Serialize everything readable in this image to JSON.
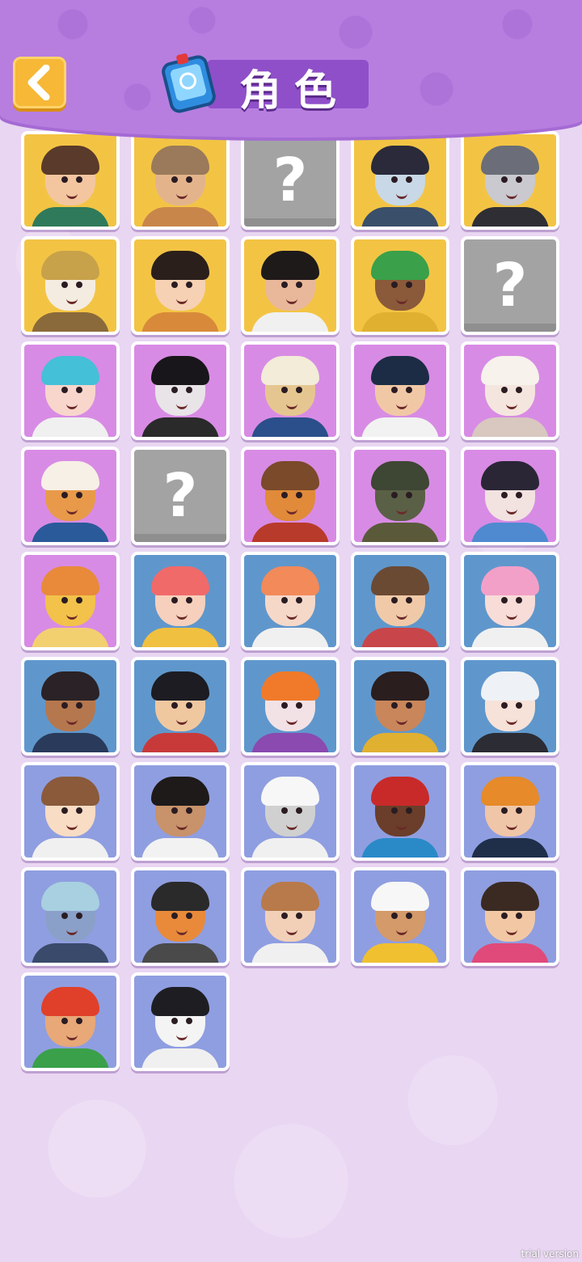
{
  "header": {
    "back_icon": "chevron-left-icon",
    "title_icon": "phone-icon",
    "title": "角色"
  },
  "colors": {
    "header": "#b77ee0",
    "page_bg": "#e9d6f2",
    "back_button": "#f6b836",
    "tier_gold": "#f3c444",
    "tier_purple": "#d88be4",
    "tier_blue": "#5f97cc",
    "tier_periwinkle": "#8f9ee0",
    "locked": "#a3a3a3"
  },
  "characters": [
    {
      "tier": "gold",
      "locked": false,
      "skin": "#f3c6a0",
      "hair": "#5a3a2a",
      "outfit": "#2f7a5a"
    },
    {
      "tier": "gold",
      "locked": false,
      "skin": "#e3b48c",
      "hair": "#9a7a5a",
      "outfit": "#c9864a"
    },
    {
      "tier": "gold",
      "locked": true,
      "label": "?"
    },
    {
      "tier": "gold",
      "locked": false,
      "skin": "#c8d8e6",
      "hair": "#2a2a3a",
      "outfit": "#3a4f6a"
    },
    {
      "tier": "gold",
      "locked": false,
      "skin": "#c9c9cf",
      "hair": "#6b6e78",
      "outfit": "#2e2e34"
    },
    {
      "tier": "gold",
      "locked": false,
      "skin": "#f4ece0",
      "hair": "#c8a24a",
      "outfit": "#8a6a3a"
    },
    {
      "tier": "gold",
      "locked": false,
      "skin": "#f6d1b3",
      "hair": "#2b1f1c",
      "outfit": "#d88a3a"
    },
    {
      "tier": "gold",
      "locked": false,
      "skin": "#e9b89a",
      "hair": "#1f1a1a",
      "outfit": "#f0f0f0"
    },
    {
      "tier": "gold",
      "locked": false,
      "skin": "#8a5a3a",
      "hair": "#3aa04a",
      "outfit": "#e0b030"
    },
    {
      "tier": "gold",
      "locked": true,
      "label": "?"
    },
    {
      "tier": "purple",
      "locked": false,
      "skin": "#f8d6cc",
      "hair": "#44c0d8",
      "outfit": "#f0f0f0"
    },
    {
      "tier": "purple",
      "locked": false,
      "skin": "#e8e4e8",
      "hair": "#18161a",
      "outfit": "#2a2a2a"
    },
    {
      "tier": "purple",
      "locked": false,
      "skin": "#e6c690",
      "hair": "#f2ecd8",
      "outfit": "#2a4f8a"
    },
    {
      "tier": "purple",
      "locked": false,
      "skin": "#f1c8a6",
      "hair": "#1c2c44",
      "outfit": "#f2f2f2"
    },
    {
      "tier": "purple",
      "locked": false,
      "skin": "#f4e6de",
      "hair": "#f7f2ec",
      "outfit": "#d8c8c0"
    },
    {
      "tier": "purple",
      "locked": false,
      "skin": "#e89a4a",
      "hair": "#f7f0e6",
      "outfit": "#2a5a9a"
    },
    {
      "tier": "purple",
      "locked": true,
      "label": "?"
    },
    {
      "tier": "purple",
      "locked": false,
      "skin": "#e08a3a",
      "hair": "#7a4a2a",
      "outfit": "#b83a2a"
    },
    {
      "tier": "purple",
      "locked": false,
      "skin": "#5a6046",
      "hair": "#3e4634",
      "outfit": "#5a5a3a"
    },
    {
      "tier": "purple",
      "locked": false,
      "skin": "#f2e2e0",
      "hair": "#2a2636",
      "outfit": "#4f8ad0"
    },
    {
      "tier": "purple",
      "locked": false,
      "skin": "#f2c24a",
      "hair": "#e88a3a",
      "outfit": "#f2d070"
    },
    {
      "tier": "blue",
      "locked": false,
      "skin": "#f6d0bc",
      "hair": "#f06a6a",
      "outfit": "#f0c040"
    },
    {
      "tier": "blue",
      "locked": false,
      "skin": "#f6d8c8",
      "hair": "#f28a5a",
      "outfit": "#f0f0f0"
    },
    {
      "tier": "blue",
      "locked": false,
      "skin": "#f0caa8",
      "hair": "#6b4a34",
      "outfit": "#c8464a"
    },
    {
      "tier": "blue",
      "locked": false,
      "skin": "#f8dcd8",
      "hair": "#f2a0c8",
      "outfit": "#f0f0f0"
    },
    {
      "tier": "blue",
      "locked": false,
      "skin": "#b5774e",
      "hair": "#2a2226",
      "outfit": "#2a3a5a"
    },
    {
      "tier": "blue",
      "locked": false,
      "skin": "#f0c8a0",
      "hair": "#1c1c22",
      "outfit": "#c83a3a"
    },
    {
      "tier": "blue",
      "locked": false,
      "skin": "#f2e2e6",
      "hair": "#f07a2a",
      "outfit": "#8a4ab0"
    },
    {
      "tier": "blue",
      "locked": false,
      "skin": "#c9865a",
      "hair": "#2a1e1e",
      "outfit": "#e0b030"
    },
    {
      "tier": "blue",
      "locked": false,
      "skin": "#f6e2d8",
      "hair": "#eef2f6",
      "outfit": "#2c2c34"
    },
    {
      "tier": "periwinkle",
      "locked": false,
      "skin": "#f8dcc4",
      "hair": "#8a5a3a",
      "outfit": "#f0f0f0"
    },
    {
      "tier": "periwinkle",
      "locked": false,
      "skin": "#c8926a",
      "hair": "#1e1a1a",
      "outfit": "#f2f2f2"
    },
    {
      "tier": "periwinkle",
      "locked": false,
      "skin": "#d0d0d0",
      "hair": "#f7f7f7",
      "outfit": "#f0f0f0"
    },
    {
      "tier": "periwinkle",
      "locked": false,
      "skin": "#6a3e2a",
      "hair": "#c82a2a",
      "outfit": "#2a8ac8"
    },
    {
      "tier": "periwinkle",
      "locked": false,
      "skin": "#f0c6a8",
      "hair": "#e68a2a",
      "outfit": "#1f2f4a"
    },
    {
      "tier": "periwinkle",
      "locked": false,
      "skin": "#8aa0c8",
      "hair": "#a8d0e0",
      "outfit": "#3a4a6a"
    },
    {
      "tier": "periwinkle",
      "locked": false,
      "skin": "#e88a3a",
      "hair": "#2a2a2a",
      "outfit": "#4a4a4a"
    },
    {
      "tier": "periwinkle",
      "locked": false,
      "skin": "#f2d0b8",
      "hair": "#b87a4a",
      "outfit": "#f0f0f0"
    },
    {
      "tier": "periwinkle",
      "locked": false,
      "skin": "#d49a6a",
      "hair": "#f7f7f7",
      "outfit": "#f0c030"
    },
    {
      "tier": "periwinkle",
      "locked": false,
      "skin": "#f2c8a4",
      "hair": "#3a2a22",
      "outfit": "#e04a7a"
    },
    {
      "tier": "periwinkle",
      "locked": false,
      "skin": "#e8a878",
      "hair": "#e0402a",
      "outfit": "#3aa04a"
    },
    {
      "tier": "periwinkle",
      "locked": false,
      "skin": "#f4f4f4",
      "hair": "#1e1e22",
      "outfit": "#f0f0f0"
    }
  ],
  "watermark": "trial version"
}
